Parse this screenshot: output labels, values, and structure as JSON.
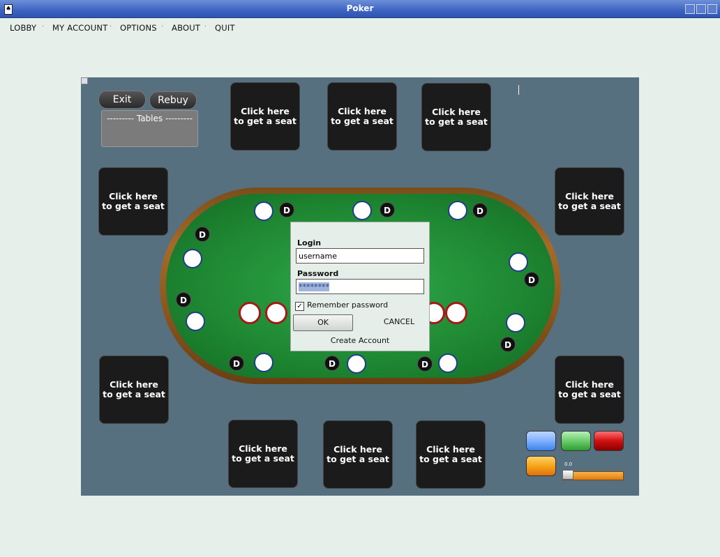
{
  "window": {
    "title": "Poker"
  },
  "menu": [
    {
      "label": "LOBBY"
    },
    {
      "label": "MY ACCOUNT"
    },
    {
      "label": "OPTIONS"
    },
    {
      "label": "ABOUT"
    },
    {
      "label": "QUIT"
    }
  ],
  "controls": {
    "exit": "Exit",
    "rebuy": "Rebuy",
    "tables": "--------- Tables ---------"
  },
  "seat_text": {
    "line1": "Click here",
    "line2": "to get a seat"
  },
  "dealer_label": "D",
  "login": {
    "login_label": "Login",
    "username_value": "username",
    "password_label": "Password",
    "password_value": "********",
    "remember_label": "Remember password",
    "remember_checked": true,
    "ok": "OK",
    "cancel": "CANCEL",
    "create_account": "Create Account"
  },
  "slider": {
    "value_text": "0.0"
  },
  "colors": {
    "table_bg": "#567080",
    "felt": "#1f8a33",
    "rim": "#a46b2a",
    "chip_border": "#1e3d8a",
    "bet_red": "#a31a1a"
  }
}
